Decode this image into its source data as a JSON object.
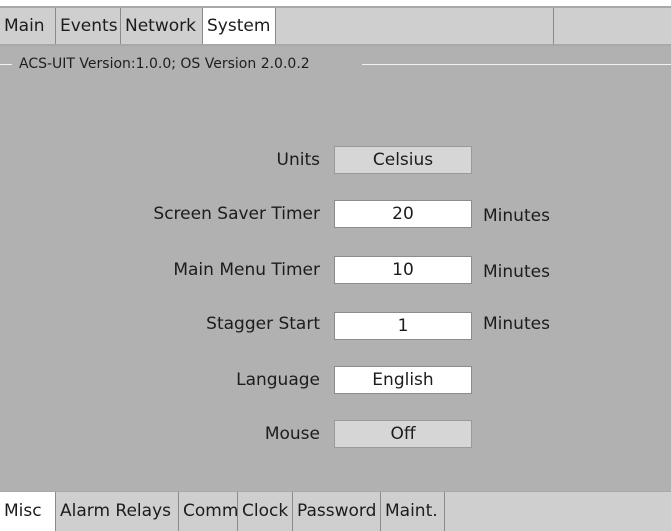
{
  "top_tabs": [
    {
      "label": "Main",
      "active": false
    },
    {
      "label": "Events",
      "active": false
    },
    {
      "label": "Network",
      "active": false
    },
    {
      "label": "System",
      "active": true
    }
  ],
  "version_group": {
    "title": "ACS-UIT Version:1.0.0; OS Version  2.0.0.2"
  },
  "settings": {
    "units": {
      "label": "Units",
      "value": "Celsius"
    },
    "screen_saver_timer": {
      "label": "Screen Saver Timer",
      "value": "20",
      "unit": "Minutes"
    },
    "main_menu_timer": {
      "label": "Main Menu Timer",
      "value": "10",
      "unit": "Minutes"
    },
    "stagger_start": {
      "label": "Stagger Start",
      "value": "1",
      "unit": "Minutes"
    },
    "language": {
      "label": "Language",
      "value": "English"
    },
    "mouse": {
      "label": "Mouse",
      "value": "Off"
    }
  },
  "bottom_tabs": [
    {
      "label": "Misc",
      "active": true
    },
    {
      "label": "Alarm Relays",
      "active": false
    },
    {
      "label": "Comm",
      "active": false
    },
    {
      "label": "Clock",
      "active": false
    },
    {
      "label": "Password",
      "active": false
    },
    {
      "label": "Maint.",
      "active": false
    }
  ]
}
